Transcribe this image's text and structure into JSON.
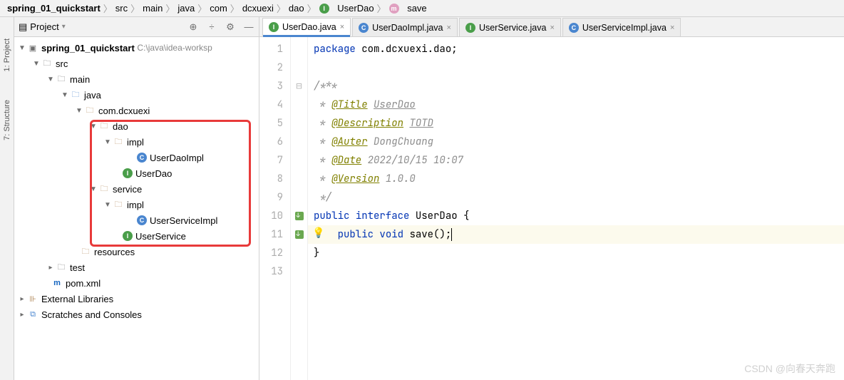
{
  "breadcrumbs": [
    "spring_01_quickstart",
    "src",
    "main",
    "java",
    "com",
    "dcxuexi",
    "dao",
    "UserDao",
    "save"
  ],
  "breadcrumb_icons": [
    "",
    "",
    "",
    "",
    "",
    "",
    "",
    "I",
    "m"
  ],
  "tool_window": {
    "title": "Project"
  },
  "side_tabs": {
    "project": "1: Project",
    "structure": "7: Structure"
  },
  "tabs": [
    {
      "label": "UserDao.java",
      "icon": "I",
      "active": true
    },
    {
      "label": "UserDaoImpl.java",
      "icon": "C",
      "active": false
    },
    {
      "label": "UserService.java",
      "icon": "I",
      "active": false
    },
    {
      "label": "UserServiceImpl.java",
      "icon": "C",
      "active": false
    }
  ],
  "tree": {
    "root": {
      "name": "spring_01_quickstart",
      "path": "C:\\java\\idea-worksp"
    },
    "src": "src",
    "main": "main",
    "java": "java",
    "pkg": "com.dcxuexi",
    "dao": "dao",
    "dao_impl": "impl",
    "userDaoImpl": "UserDaoImpl",
    "userDao": "UserDao",
    "service": "service",
    "svc_impl": "impl",
    "userServiceImpl": "UserServiceImpl",
    "userService": "UserService",
    "resources": "resources",
    "test": "test",
    "pom": "pom.xml",
    "ext": "External Libraries",
    "scratch": "Scratches and Consoles"
  },
  "code": {
    "package_kw": "package",
    "package_name": "com.dcxuexi.dao",
    "public": "public",
    "interface": "interface",
    "void": "void",
    "className": "UserDao",
    "method": "save",
    "doc": {
      "title": "@Title",
      "title_v": "UserDao",
      "desc": "@Description",
      "desc_v": "TOTD",
      "auter": "@Auter",
      "auter_v": "DongChuang",
      "date": "@Date",
      "date_v": "2022/10/15 10:07",
      "ver": "@Version",
      "ver_v": "1.0.0"
    }
  },
  "watermark": "CSDN @向春天奔跑"
}
